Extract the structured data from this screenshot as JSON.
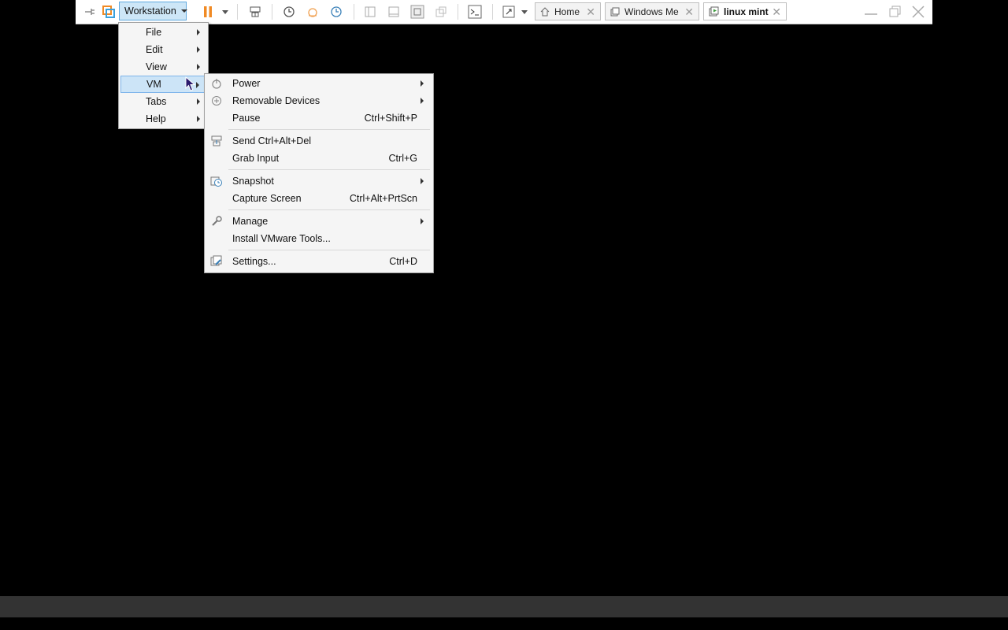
{
  "toolbar": {
    "workstation_label": "Workstation",
    "tabs": [
      {
        "label": "Home",
        "icon": "home-icon"
      },
      {
        "label": "Windows Me",
        "icon": "vm-icon"
      },
      {
        "label": "linux mint",
        "icon": "vm-running-icon",
        "active": true
      }
    ],
    "colors": {
      "accent": "#cde6f7",
      "pause": "#f08a24"
    }
  },
  "main_menu": {
    "items": [
      {
        "label": "File"
      },
      {
        "label": "Edit"
      },
      {
        "label": "View"
      },
      {
        "label": "VM",
        "highlighted": true
      },
      {
        "label": "Tabs"
      },
      {
        "label": "Help"
      }
    ]
  },
  "vm_menu": {
    "items": [
      {
        "label": "Power",
        "icon": "power-icon",
        "submenu": true
      },
      {
        "label": "Removable Devices",
        "icon": "devices-icon",
        "submenu": true
      },
      {
        "label": "Pause",
        "shortcut": "Ctrl+Shift+P"
      },
      {
        "label": "Send Ctrl+Alt+Del",
        "icon": "send-keys-icon"
      },
      {
        "label": "Grab Input",
        "shortcut": "Ctrl+G"
      },
      {
        "label": "Snapshot",
        "icon": "snapshot-icon",
        "submenu": true
      },
      {
        "label": "Capture Screen",
        "shortcut": "Ctrl+Alt+PrtScn"
      },
      {
        "label": "Manage",
        "icon": "wrench-icon",
        "submenu": true
      },
      {
        "label": "Install VMware Tools..."
      },
      {
        "label": "Settings...",
        "icon": "settings-icon",
        "shortcut": "Ctrl+D"
      }
    ]
  }
}
